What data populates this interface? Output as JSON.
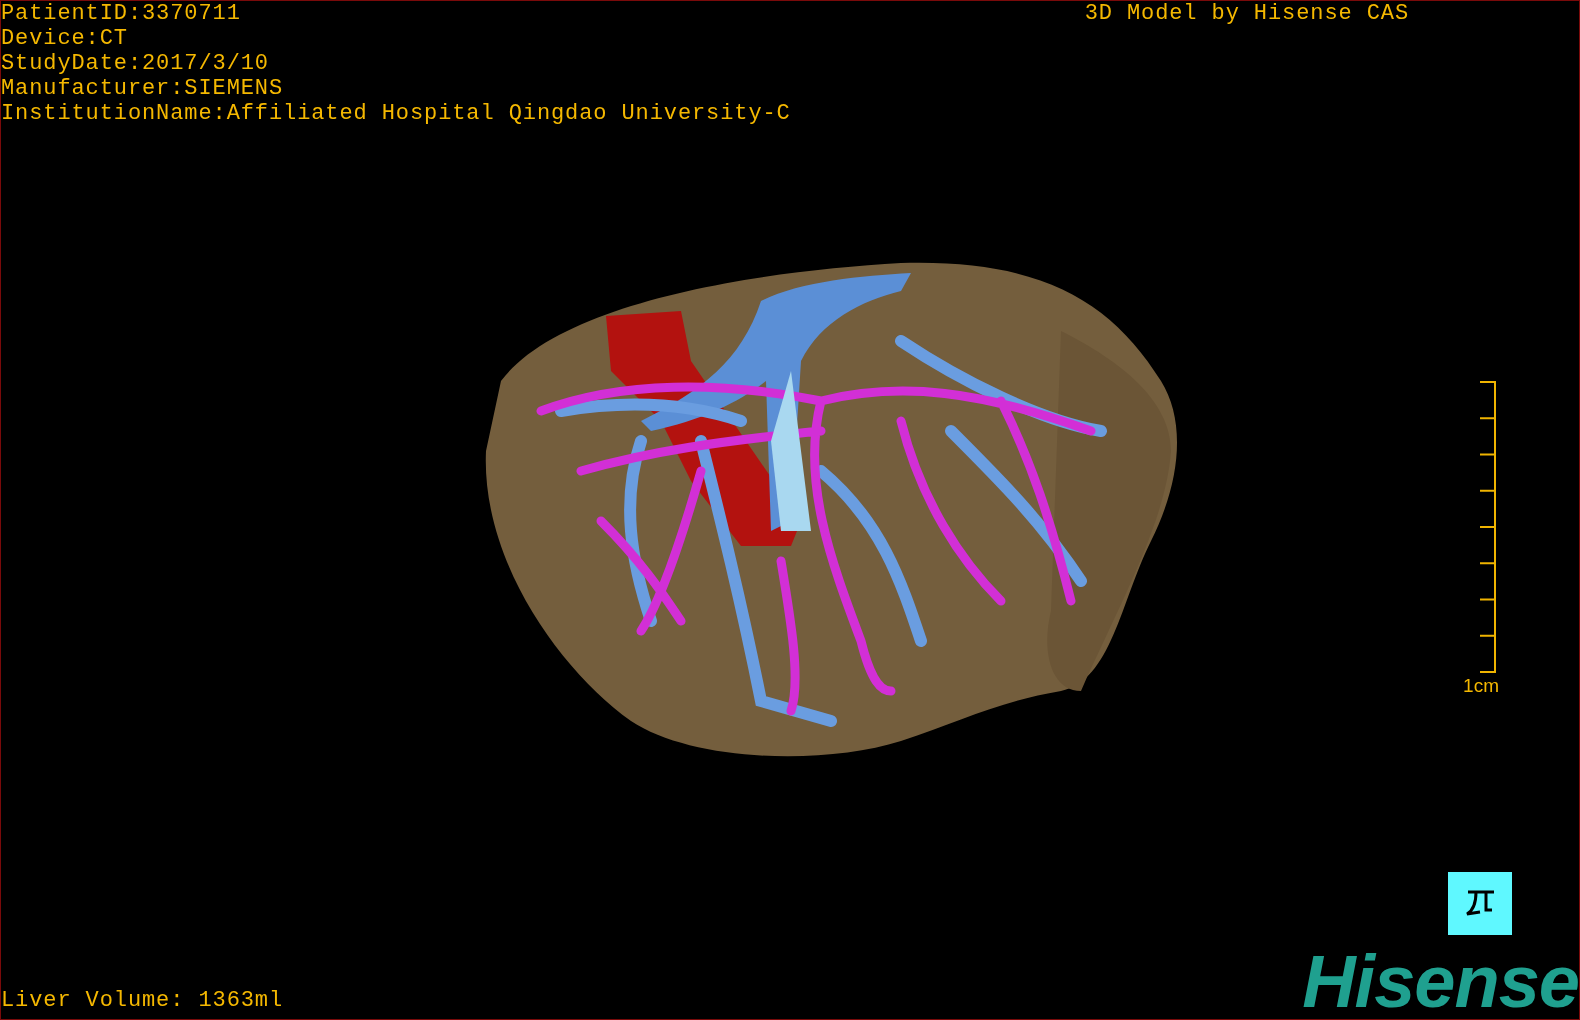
{
  "patient_info": [
    "PatientID:3370711",
    "Device:CT",
    "StudyDate:2017/3/10",
    "Manufacturer:SIEMENS",
    "InstitutionName:Affiliated Hospital Qingdao University-C"
  ],
  "title": "3D Model by Hisense CAS",
  "scale": {
    "label": "1cm"
  },
  "liver_volume": "Liver Volume: 1363ml",
  "logo": "Hisense"
}
